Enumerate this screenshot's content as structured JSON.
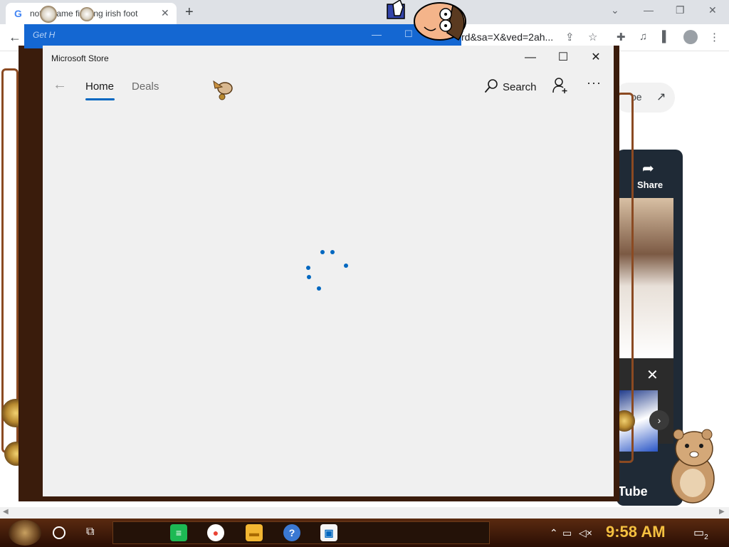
{
  "browser": {
    "tab_title": "notre dame fighting irish foot",
    "tab_close": "✕",
    "new_tab": "+",
    "url_fragment": "rd&sa=X&ved=2ah...",
    "window_controls": {
      "minimize": "—",
      "restore": "❐",
      "close": "✕"
    },
    "share_button": "pe"
  },
  "youtube": {
    "share_label": "Share",
    "logo_text": "Tube",
    "close_glyph": "✕",
    "next_glyph": "›"
  },
  "background_window": {
    "title": "Get H",
    "minimize": "—",
    "maximize": "☐"
  },
  "store": {
    "title": "Microsoft Store",
    "controls": {
      "minimize": "—",
      "maximize": "☐",
      "close": "✕"
    },
    "back_glyph": "←",
    "tabs": [
      {
        "label": "Home",
        "active": true
      },
      {
        "label": "Deals",
        "active": false
      }
    ],
    "search_label": "Search",
    "more_glyph": "···",
    "accent_color": "#0067c0"
  },
  "taskbar": {
    "clock": "9:58 AM",
    "notification_count": "2",
    "apps": [
      {
        "name": "Spotify",
        "glyph": "≡",
        "color": "#1db954"
      },
      {
        "name": "Chrome",
        "glyph": "●",
        "color": "#ea4335"
      },
      {
        "name": "File Explorer",
        "glyph": "▬",
        "color": "#f2b632"
      },
      {
        "name": "Help",
        "glyph": "?",
        "color": "#3a78d2"
      },
      {
        "name": "Microsoft Store",
        "glyph": "▣",
        "color": "#ffffff"
      }
    ]
  }
}
